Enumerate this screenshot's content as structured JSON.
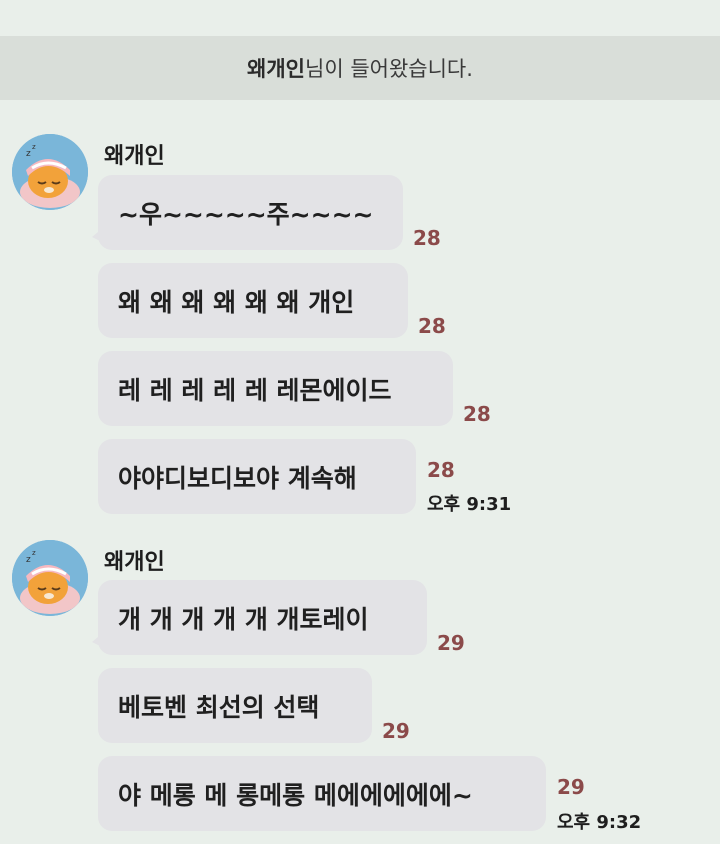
{
  "system_notice": {
    "name": "왜개인",
    "suffix": "님이 들어왔습니다."
  },
  "groups": [
    {
      "sender": "왜개인",
      "avatar_icon": "sleeping-lion-avatar-icon",
      "messages": [
        {
          "text": "~우~~~~~주~~~~",
          "unread": "28"
        },
        {
          "text": "왜 왜 왜 왜 왜 왜 개인",
          "unread": "28"
        },
        {
          "text": "레 레 레 레 레 레몬에이드",
          "unread": "28"
        },
        {
          "text": "야야디보디보야 계속해",
          "unread": "28",
          "time": "오후 9:31"
        }
      ]
    },
    {
      "sender": "왜개인",
      "avatar_icon": "sleeping-lion-avatar-icon",
      "messages": [
        {
          "text": "개 개 개 개 개 개토레이",
          "unread": "29"
        },
        {
          "text": "베토벤 최선의 선택",
          "unread": "29"
        },
        {
          "text": "야 메롱 메 롱메롱 메에에에에에~",
          "unread": "29",
          "time": "오후 9:32"
        }
      ]
    }
  ],
  "colors": {
    "background": "#e9efea",
    "bubble": "#e3e3e6",
    "unread": "#8b4a4a",
    "avatar_bg": "#7ab6d9"
  }
}
